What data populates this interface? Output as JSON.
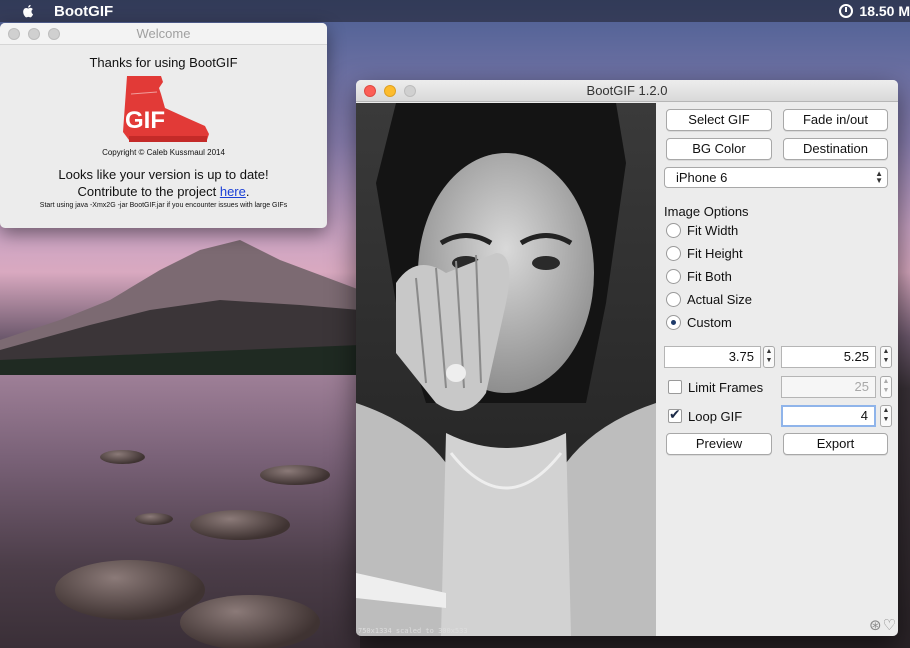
{
  "menubar": {
    "app_name": "BootGIF",
    "clock": "18.50 M"
  },
  "welcome": {
    "title": "Welcome",
    "thanks": "Thanks for using BootGIF",
    "logo_text": "GIF",
    "copyright": "Copyright © Caleb Kussmaul 2014",
    "uptodate": "Looks like your version is up to date!",
    "contribute_prefix": "Contribute to the project ",
    "contribute_link": "here",
    "contribute_suffix": ".",
    "hint": "Start using java -Xmx2G -jar BootGIF.jar if you encounter issues with large GIFs"
  },
  "main": {
    "title": "BootGIF 1.2.0",
    "preview_caption": "750x1334 scaled to 300x533",
    "buttons": {
      "select_gif": "Select GIF",
      "fade": "Fade in/out",
      "bg_color": "BG Color",
      "destination": "Destination",
      "preview": "Preview",
      "export": "Export"
    },
    "device": "iPhone 6",
    "image_options_label": "Image Options",
    "options": [
      {
        "label": "Fit Width",
        "selected": false
      },
      {
        "label": "Fit Height",
        "selected": false
      },
      {
        "label": "Fit Both",
        "selected": false
      },
      {
        "label": "Actual Size",
        "selected": false
      },
      {
        "label": "Custom",
        "selected": true
      }
    ],
    "width_value": "3.75",
    "height_value": "5.25",
    "limit_frames_label": "Limit Frames",
    "limit_frames_checked": false,
    "limit_frames_value": "25",
    "loop_gif_label": "Loop GIF",
    "loop_gif_checked": true,
    "loop_value": "4"
  },
  "colors": {
    "close": "#fc5f57",
    "minimize": "#fdbc2e",
    "link": "#1a3fd6",
    "logo_red": "#e23a37"
  }
}
